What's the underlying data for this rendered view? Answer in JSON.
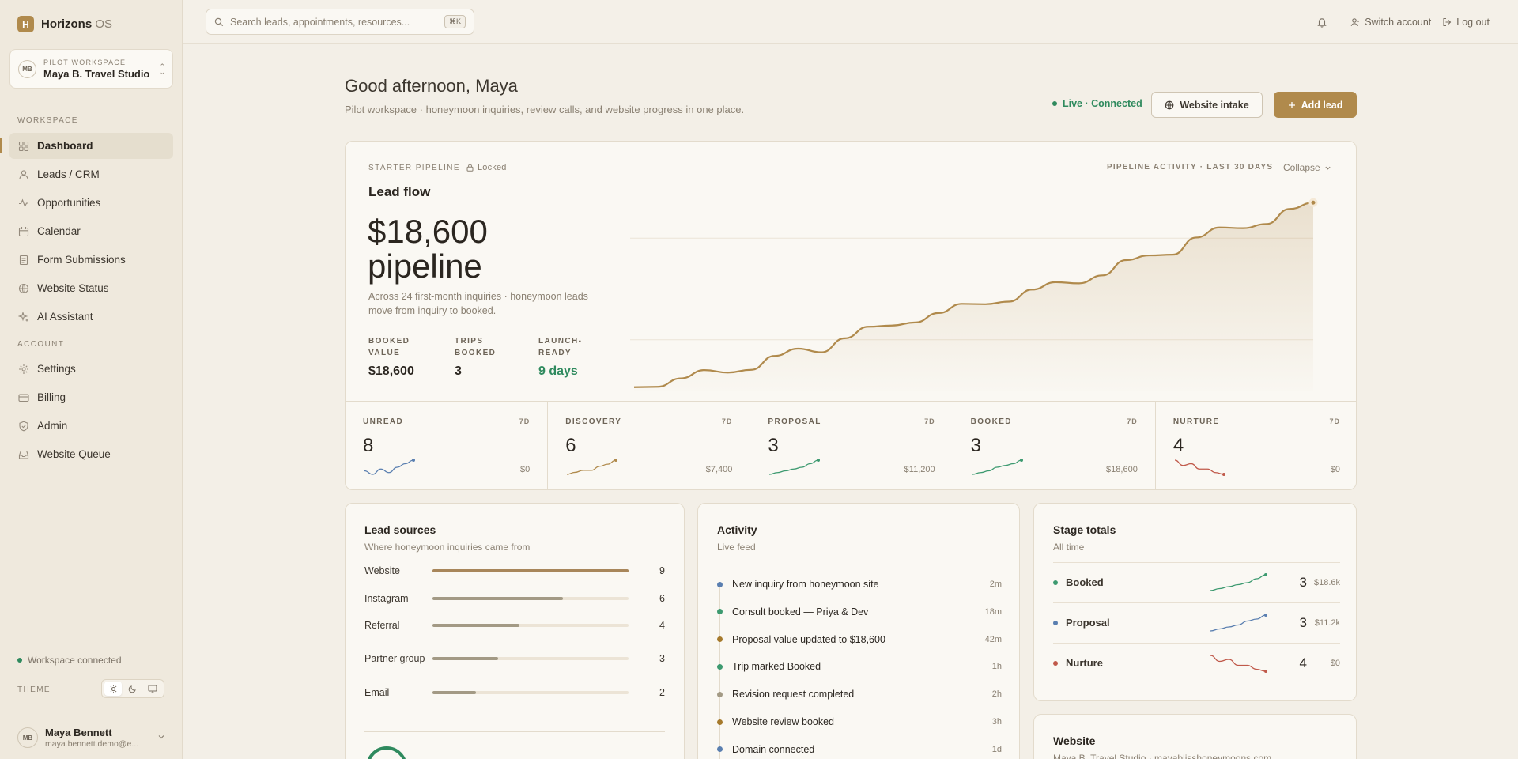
{
  "brand": {
    "logo": "H",
    "name": "Horizons",
    "suffix": "OS"
  },
  "workspace": {
    "avatar": "MB",
    "kicker": "PILOT WORKSPACE",
    "name": "Maya B. Travel Studio"
  },
  "sidebar": {
    "section_workspace": "WORKSPACE",
    "section_account": "ACCOUNT",
    "workspace_items": [
      {
        "label": "Dashboard",
        "icon": "grid-icon",
        "active": true
      },
      {
        "label": "Leads / CRM",
        "icon": "user-icon"
      },
      {
        "label": "Opportunities",
        "icon": "activity-icon"
      },
      {
        "label": "Calendar",
        "icon": "calendar-icon"
      },
      {
        "label": "Form Submissions",
        "icon": "file-icon"
      },
      {
        "label": "Website Status",
        "icon": "globe-icon"
      },
      {
        "label": "AI Assistant",
        "icon": "sparkle-icon"
      }
    ],
    "account_items": [
      {
        "label": "Settings",
        "icon": "gear-icon"
      },
      {
        "label": "Billing",
        "icon": "card-icon"
      },
      {
        "label": "Admin",
        "icon": "shield-icon"
      },
      {
        "label": "Website Queue",
        "icon": "inbox-icon"
      }
    ],
    "status": "Workspace connected",
    "theme_label": "THEME"
  },
  "user": {
    "avatar": "MB",
    "name": "Maya Bennett",
    "email": "maya.bennett.demo@e..."
  },
  "topbar": {
    "search_placeholder": "Search leads, appointments, resources...",
    "shortcut": "⌘K",
    "switch_account": "Switch account",
    "logout": "Log out"
  },
  "header": {
    "greeting": "Good afternoon, Maya",
    "subline": "Pilot workspace · honeymoon inquiries, review calls, and website progress in one place.",
    "live_status": "Live · Connected",
    "intake_button": "Website intake",
    "add_button": "Add lead"
  },
  "pipeline": {
    "kicker": "STARTER PIPELINE",
    "locked": "Locked",
    "title": "Lead flow",
    "amount": "$18,600",
    "amount_unit": "pipeline",
    "description": "Across 24 first-month inquiries · honeymoon leads move from inquiry to booked.",
    "stats": [
      {
        "label": "BOOKED VALUE",
        "value": "$18,600",
        "green": false
      },
      {
        "label": "TRIPS BOOKED",
        "value": "3",
        "green": false
      },
      {
        "label": "LAUNCH-READY",
        "value": "9 days",
        "green": true
      }
    ],
    "activity_label": "PIPELINE ACTIVITY · LAST 30 DAYS",
    "collapse": "Collapse",
    "accent": "#b08a4c"
  },
  "chart_data": {
    "type": "area",
    "title": "",
    "xlabel": "",
    "ylabel": "",
    "grid": true,
    "x": [
      1,
      2,
      3,
      4,
      5,
      6,
      7,
      8,
      9,
      10,
      11,
      12,
      13,
      14,
      15,
      16,
      17,
      18,
      19,
      20,
      21,
      22,
      23,
      24,
      25,
      26,
      27,
      28,
      29,
      30
    ],
    "series": [
      {
        "values": [
          4,
          10,
          13,
          19,
          24,
          29,
          37,
          46,
          50,
          64,
          70,
          76,
          86,
          91,
          97,
          104,
          110,
          116,
          124,
          131,
          139,
          149,
          158,
          166,
          181,
          187,
          193,
          202,
          212,
          222
        ]
      }
    ],
    "ylim": [
      0,
      240
    ]
  },
  "stages": [
    {
      "name": "UNREAD",
      "period": "7D",
      "count": "8",
      "value": "$0",
      "color": "#5a7fb0",
      "trend": [
        3,
        1,
        4,
        2,
        5,
        7,
        9
      ]
    },
    {
      "name": "DISCOVERY",
      "period": "7D",
      "count": "6",
      "value": "$7,400",
      "color": "#b08a4c",
      "trend": [
        1,
        2,
        3,
        3,
        5,
        6,
        8
      ]
    },
    {
      "name": "PROPOSAL",
      "period": "7D",
      "count": "3",
      "value": "$11,200",
      "color": "#3d9a70",
      "trend": [
        1,
        2,
        3,
        4,
        5,
        7,
        9
      ]
    },
    {
      "name": "BOOKED",
      "period": "7D",
      "count": "3",
      "value": "$18,600",
      "color": "#3d9a70",
      "trend": [
        1,
        2,
        3,
        5,
        6,
        7,
        9
      ]
    },
    {
      "name": "NURTURE",
      "period": "7D",
      "count": "4",
      "value": "$0",
      "color": "#c0594a",
      "trend": [
        9,
        6,
        7,
        4,
        4,
        2,
        1
      ]
    }
  ],
  "sources": {
    "title": "Lead sources",
    "subtitle": "Where honeymoon inquiries came from",
    "items": [
      {
        "label": "Website",
        "value": 9,
        "color": "#a8865a"
      },
      {
        "label": "Instagram",
        "value": 6,
        "color": "#a39a85"
      },
      {
        "label": "Referral",
        "value": 4,
        "color": "#a39a85"
      },
      {
        "label": "Partner group",
        "value": 3,
        "color": "#a39a85"
      },
      {
        "label": "Email",
        "value": 2,
        "color": "#a39a85"
      }
    ],
    "max": 9
  },
  "activity": {
    "title": "Activity",
    "subtitle": "Live feed",
    "items": [
      {
        "text": "New inquiry from honeymoon site",
        "time": "2m",
        "color": "#5a7fb0"
      },
      {
        "text": "Consult booked — Priya & Dev",
        "time": "18m",
        "color": "#3d9a70"
      },
      {
        "text": "Proposal value updated to $18,600",
        "time": "42m",
        "color": "#a67a2c"
      },
      {
        "text": "Trip marked Booked",
        "time": "1h",
        "color": "#3d9a70"
      },
      {
        "text": "Revision request completed",
        "time": "2h",
        "color": "#a39a85"
      },
      {
        "text": "Website review booked",
        "time": "3h",
        "color": "#a67a2c"
      },
      {
        "text": "Domain connected",
        "time": "1d",
        "color": "#5a7fb0"
      }
    ]
  },
  "totals": {
    "title": "Stage totals",
    "subtitle": "All time",
    "items": [
      {
        "name": "Booked",
        "count": "3",
        "value": "$18.6k",
        "color": "#3d9a70",
        "trend": [
          1,
          2,
          3,
          4,
          5,
          7,
          9
        ]
      },
      {
        "name": "Proposal",
        "count": "3",
        "value": "$11.2k",
        "color": "#5a7fb0",
        "trend": [
          1,
          2,
          3,
          4,
          6,
          7,
          9
        ]
      },
      {
        "name": "Nurture",
        "count": "4",
        "value": "$0",
        "color": "#c0594a",
        "trend": [
          9,
          6,
          7,
          4,
          4,
          2,
          1
        ]
      }
    ]
  },
  "website": {
    "title": "Website",
    "subtitle": "Maya B. Travel Studio · mayablisshoneymoons.com"
  }
}
